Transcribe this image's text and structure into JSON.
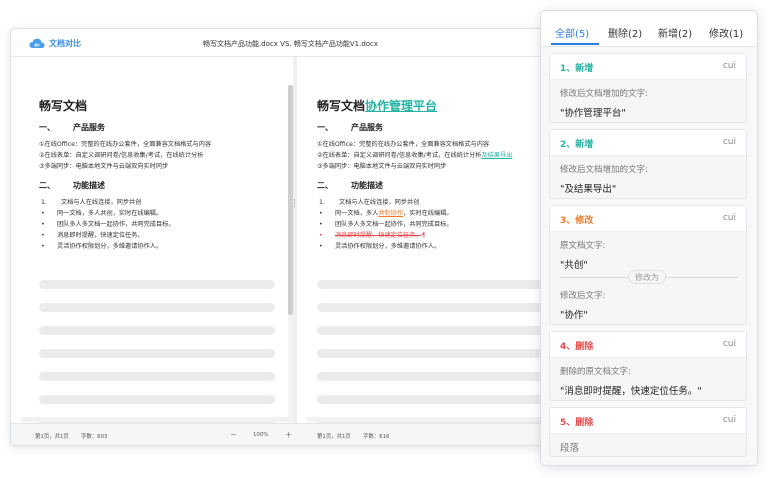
{
  "app": {
    "logo_text": "文档对比",
    "window_title": "畅写文档产品功能.docx VS. 畅写文档产品功能V1.docx"
  },
  "colors": {
    "insert": "#26b3a3",
    "modify": "#f07a2a",
    "delete": "#e54a4a",
    "accent": "#2f7de1"
  },
  "left_doc": {
    "title": "畅写文档",
    "sec1": {
      "num": "一、",
      "heading": "产品服务"
    },
    "sec1_lines": [
      "①在线Office：完整的在线办公套件，全面兼容文档格式与内容",
      "②在线表单：自定义调研问卷/信息收集/考试，在线统计分析",
      "③多端同步：电脑本地文件与云端双向实时同步"
    ],
    "sec2": {
      "num": "二、",
      "heading": "功能描述"
    },
    "list": [
      {
        "mark": "1.",
        "text": "文档与人在线连接，同步共创"
      },
      {
        "mark": "•",
        "text": "同一文档，多人共创，实时在线编辑。"
      },
      {
        "mark": "•",
        "text": "团队多人多文档一起协作，共同完成目标。"
      },
      {
        "mark": "•",
        "text": "消息即时提醒，快速定位任务。"
      },
      {
        "mark": "•",
        "text": "灵活协作权限划分，多维邀请协作人。"
      }
    ]
  },
  "right_doc": {
    "title": "畅写文档",
    "title_insert": "协作管理平台",
    "sec1": {
      "num": "一、",
      "heading": "产品服务"
    },
    "line1": "①在线Office：完整的在线办公套件，全面兼容文档格式与内容",
    "line2": "②在线表单：自定义调研问卷/信息收集/考试，在线统计分析",
    "line2_insert": "及结果导出",
    "line3": "③多端同步：电脑本地文件与云端双向实时同步",
    "sec2": {
      "num": "二、",
      "heading": "功能描述"
    },
    "item1": {
      "mark": "1.",
      "text": "文档与人在线连接，同步共创"
    },
    "item2": {
      "mark": "•",
      "pre": "同一文档，多人",
      "changed": "共制协作",
      "post": "，实时在线编辑。"
    },
    "item3": {
      "mark": "•",
      "text": "团队多人多文档一起协作，共同完成目标。"
    },
    "item4": {
      "mark": "•",
      "deleted": "消息即时提醒，快速定位任务。",
      "pilcrow": "¶"
    },
    "item5": {
      "mark": "•",
      "text": "灵活协作权限划分，多维邀请协作人。"
    }
  },
  "status_left": {
    "page": "第1页，共1页",
    "words": "字数：603",
    "zoom_minus": "－",
    "zoom": "100%",
    "zoom_plus": "＋"
  },
  "status_right": {
    "page": "第1页，共1页",
    "words": "字数：616"
  },
  "panel": {
    "tabs": [
      "全部(5)",
      "删除(2)",
      "新增(2)",
      "修改(1)"
    ],
    "cards": [
      {
        "title": "1、新增",
        "user": "cui",
        "label": "修改后文档增加的文字:",
        "text": "\"协作管理平台\""
      },
      {
        "title": "2、新增",
        "user": "cui",
        "label": "修改后文档增加的文字:",
        "text": "\"及结果导出\""
      },
      {
        "title": "3、修改",
        "user": "cui",
        "label_orig": "原文档文字:",
        "text_orig": "\"共创\"",
        "sep": "修改为",
        "label_new": "修改后文字:",
        "text_new": "\"协作\""
      },
      {
        "title": "4、删除",
        "user": "cui",
        "label": "删除的原文档文字:",
        "text": "\"消息即时提醒，快速定位任务。\""
      },
      {
        "title": "5、删除",
        "user": "cui",
        "label": "段落"
      }
    ]
  }
}
